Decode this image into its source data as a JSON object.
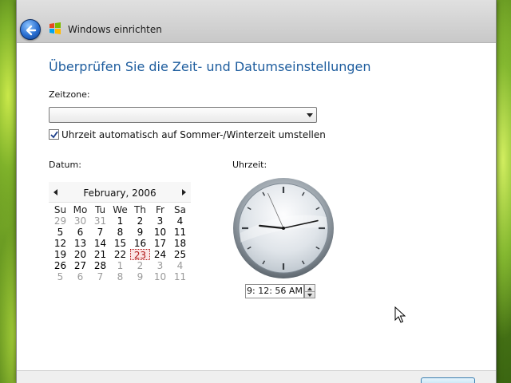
{
  "window": {
    "title": "Windows einrichten"
  },
  "page": {
    "heading": "Überprüfen Sie die Zeit- und Datumseinstellungen",
    "timezone_label": "Zeitzone:",
    "timezone_value": "",
    "dst_label": "Uhrzeit automatisch auf Sommer-/Winterzeit umstellen",
    "dst_checked": true,
    "date_label": "Datum:",
    "time_label": "Uhrzeit:"
  },
  "calendar": {
    "month_title": "February, 2006",
    "weekdays": [
      "Su",
      "Mo",
      "Tu",
      "We",
      "Th",
      "Fr",
      "Sa"
    ],
    "weeks": [
      [
        {
          "d": "29",
          "o": true
        },
        {
          "d": "30",
          "o": true
        },
        {
          "d": "31",
          "o": true
        },
        {
          "d": "1"
        },
        {
          "d": "2"
        },
        {
          "d": "3"
        },
        {
          "d": "4"
        }
      ],
      [
        {
          "d": "5"
        },
        {
          "d": "6"
        },
        {
          "d": "7"
        },
        {
          "d": "8"
        },
        {
          "d": "9"
        },
        {
          "d": "10"
        },
        {
          "d": "11"
        }
      ],
      [
        {
          "d": "12"
        },
        {
          "d": "13"
        },
        {
          "d": "14"
        },
        {
          "d": "15"
        },
        {
          "d": "16"
        },
        {
          "d": "17"
        },
        {
          "d": "18"
        }
      ],
      [
        {
          "d": "19"
        },
        {
          "d": "20"
        },
        {
          "d": "21"
        },
        {
          "d": "22"
        },
        {
          "d": "23",
          "sel": true
        },
        {
          "d": "24"
        },
        {
          "d": "25"
        }
      ],
      [
        {
          "d": "26"
        },
        {
          "d": "27"
        },
        {
          "d": "28"
        },
        {
          "d": "1",
          "o": true
        },
        {
          "d": "2",
          "o": true
        },
        {
          "d": "3",
          "o": true
        },
        {
          "d": "4",
          "o": true
        }
      ],
      [
        {
          "d": "5",
          "o": true
        },
        {
          "d": "6",
          "o": true
        },
        {
          "d": "7",
          "o": true
        },
        {
          "d": "8",
          "o": true
        },
        {
          "d": "9",
          "o": true
        },
        {
          "d": "10",
          "o": true
        },
        {
          "d": "11",
          "o": true
        }
      ]
    ]
  },
  "clock": {
    "hour": 9,
    "minute": 12,
    "second": 56,
    "time_text": "9: 12: 56 AM"
  },
  "colors": {
    "heading": "#1e5d9e",
    "selected_day": "#b01818"
  },
  "icons": {
    "back": "back-arrow-icon",
    "logo": "windows-logo-icon",
    "cursor": "mouse-pointer-icon"
  }
}
